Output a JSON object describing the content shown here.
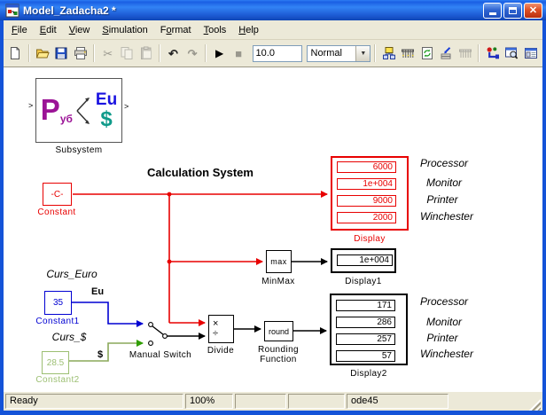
{
  "window": {
    "title": "Model_Zadacha2 *",
    "controls": {
      "close_glyph": "✕"
    }
  },
  "menu": {
    "items": [
      {
        "label": "File",
        "u": 0
      },
      {
        "label": "Edit",
        "u": 0
      },
      {
        "label": "View",
        "u": 0
      },
      {
        "label": "Simulation",
        "u": 0
      },
      {
        "label": "Format",
        "u": 1
      },
      {
        "label": "Tools",
        "u": 0
      },
      {
        "label": "Help",
        "u": 0
      }
    ]
  },
  "toolbar": {
    "stop_time": "10.0",
    "mode": "Normal",
    "dropdown_glyph": "▼",
    "glyphs": {
      "cut": "✂",
      "undo": "↶",
      "redo": "↷",
      "play": "▶",
      "stop": "■"
    }
  },
  "diagram": {
    "title": "Calculation System",
    "subsystem": {
      "label": "Subsystem",
      "icon_p": "P",
      "icon_sub": "уб",
      "icon_eu": "Eu",
      "icon_dollar": "$",
      "port": ">"
    },
    "constant": {
      "value": "-C-",
      "label": "Constant"
    },
    "constant1": {
      "value": "35",
      "label": "Constant1",
      "annotation": "Curs_Euro",
      "signal": "Eu"
    },
    "constant2": {
      "value": "28.5",
      "label": "Constant2",
      "annotation": "Curs_$",
      "signal": "$"
    },
    "manual_switch": {
      "label": "Manual Switch"
    },
    "minmax": {
      "text": "max",
      "label": "MinMax"
    },
    "divide": {
      "sym_mul": "×",
      "sym_div": "÷",
      "label": "Divide"
    },
    "rounding": {
      "text": "round",
      "label1": "Rounding",
      "label2": "Function"
    },
    "display": {
      "values": [
        "6000",
        "1e+004",
        "9000",
        "2000"
      ],
      "label": "Display"
    },
    "display1": {
      "value": "1e+004",
      "label": "Display1"
    },
    "display2": {
      "values": [
        "171",
        "286",
        "257",
        "57"
      ],
      "label": "Display2"
    },
    "side_labels_top": [
      "Processor",
      "Monitor",
      "Printer",
      "Winchester"
    ],
    "side_labels_bottom": [
      "Processor",
      "Monitor",
      "Printer",
      "Winchester"
    ]
  },
  "status": {
    "state": "Ready",
    "zoom": "100%",
    "solver": "ode45"
  },
  "colors": {
    "wire_red": "#e80000",
    "wire_black": "#000000",
    "constant1_blue": "#0000d2",
    "constant2_green": "#9cbf72",
    "titlebar_blue": "#1a5fe4",
    "xp_face": "#ece9d8"
  }
}
